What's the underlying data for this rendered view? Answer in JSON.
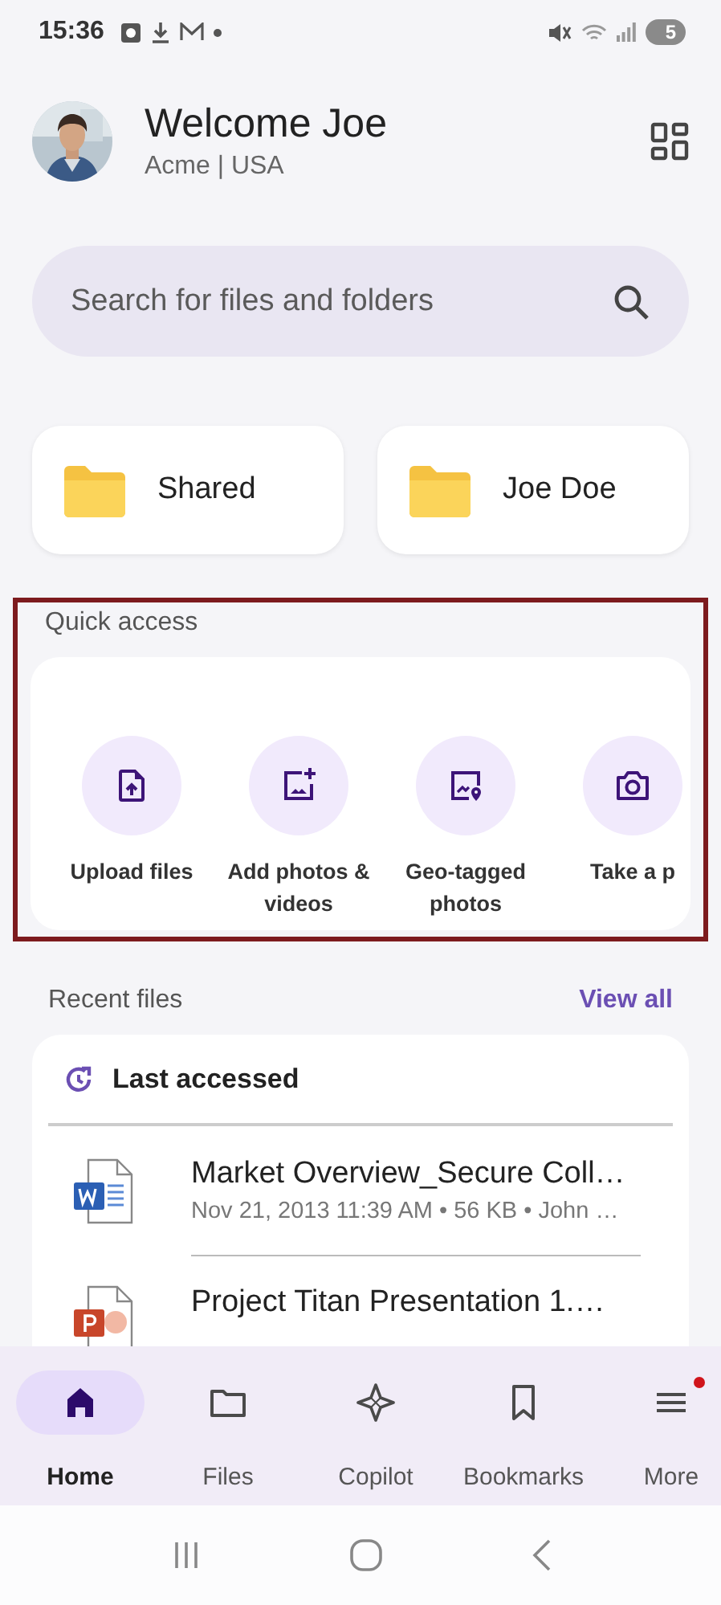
{
  "status_bar": {
    "time": "15:36",
    "battery": "5"
  },
  "header": {
    "title": "Welcome Joe",
    "subtitle": "Acme | USA"
  },
  "search": {
    "placeholder": "Search for files and folders"
  },
  "folders": [
    {
      "label": "Shared"
    },
    {
      "label": "Joe Doe"
    }
  ],
  "quick_access": {
    "title": "Quick access",
    "highlighted": true,
    "actions": [
      {
        "kind": "upload",
        "label": "Upload files"
      },
      {
        "kind": "add_photos",
        "label": "Add photos & videos"
      },
      {
        "kind": "geo",
        "label": "Geo-tagged photos"
      },
      {
        "kind": "camera",
        "label": "Take a p"
      }
    ]
  },
  "recent_files": {
    "title": "Recent files",
    "link": "View all",
    "group": "Last accessed",
    "files": [
      {
        "kind": "word",
        "name": "Market Overview_Secure Coll…",
        "meta": "Nov 21, 2013 11:39 AM • 56 KB • John …"
      },
      {
        "kind": "powerpoint",
        "name": "Project Titan Presentation 1.…"
      }
    ]
  },
  "bottom_nav": [
    {
      "kind": "home",
      "label": "Home",
      "selected": true,
      "badge": false
    },
    {
      "kind": "files",
      "label": "Files",
      "selected": false,
      "badge": false
    },
    {
      "kind": "copilot",
      "label": "Copilot",
      "selected": false,
      "badge": false
    },
    {
      "kind": "bookmarks",
      "label": "Bookmarks",
      "selected": false,
      "badge": false
    },
    {
      "kind": "more",
      "label": "More",
      "selected": false,
      "badge": true
    }
  ]
}
